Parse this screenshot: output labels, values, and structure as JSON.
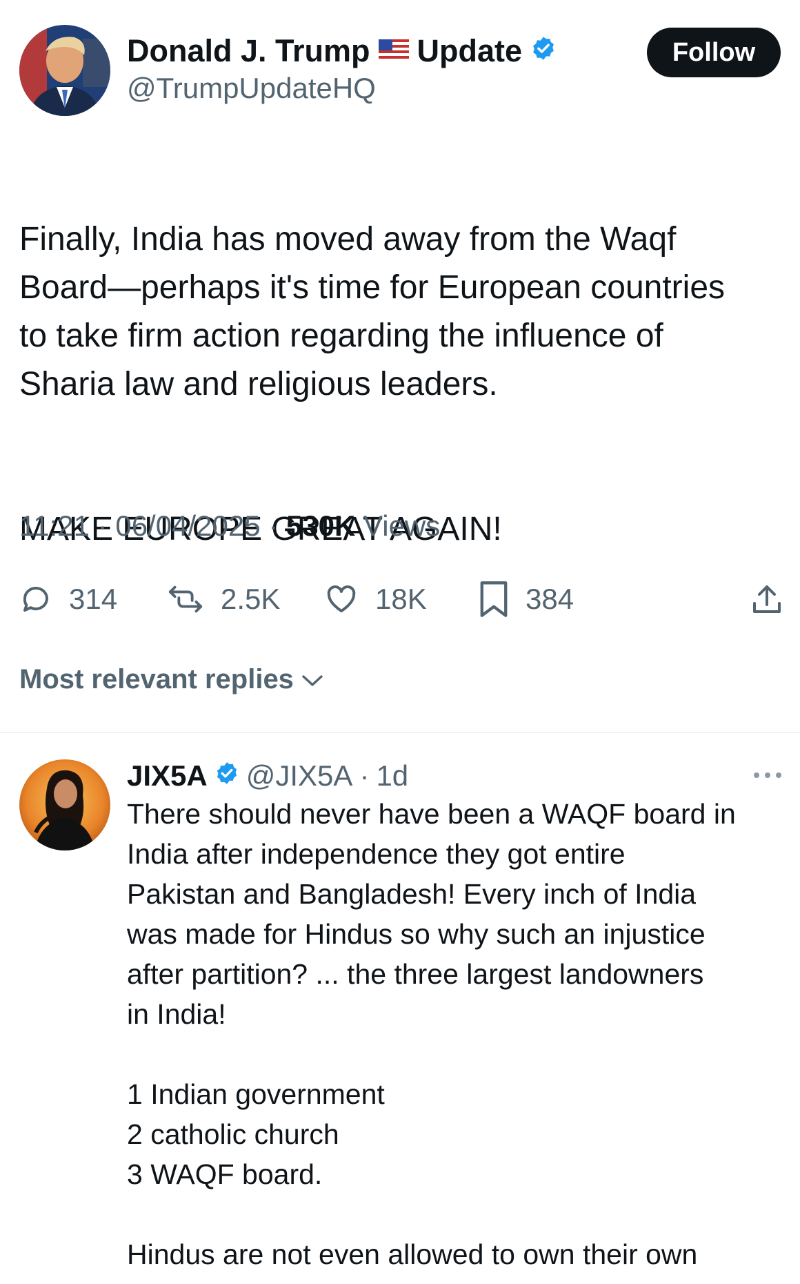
{
  "post": {
    "author_name": "Donald J. Trump",
    "author_name_suffix": "Update",
    "author_handle": "@TrumpUpdateHQ",
    "follow_label": "Follow",
    "text_main": "Finally, India has moved away from the Waqf\nBoard—perhaps it's time for European countries\nto take firm action regarding the influence of\nSharia law and religious leaders.",
    "text_slogan": "MAKE EUROPE GREAT AGAIN!",
    "time": "11:21",
    "date": "06/04/2025",
    "views_count": "530K",
    "views_label": "Views",
    "separator": "·"
  },
  "actions": {
    "replies": "314",
    "reposts": "2.5K",
    "likes": "18K",
    "bookmarks": "384"
  },
  "replies_sort": {
    "label": "Most relevant replies"
  },
  "reply": {
    "name": "JIX5A",
    "handle": "@JIX5A",
    "separator": "·",
    "time": "1d",
    "text": "There should never have been a WAQF board in\nIndia after independence they got entire\nPakistan and Bangladesh! Every inch of India\nwas made for Hindus so why such an injustice\nafter partition? ... the three largest landowners\nin India!\n\n 1 Indian government\n2 catholic church\n3 WAQF board.\n\nHindus are not even allowed to own their own"
  },
  "icons": {
    "verified": "verified-badge-icon",
    "flag": "us-flag-icon",
    "reply": "reply-icon",
    "repost": "repost-icon",
    "like": "heart-icon",
    "bookmark": "bookmark-icon",
    "share": "share-icon",
    "chevron": "chevron-down-icon",
    "more": "more-icon"
  },
  "colors": {
    "verified_blue": "#1d9bf0",
    "text_primary": "#0f1419",
    "text_secondary": "#536471",
    "follow_bg": "#0f1419",
    "divider": "#e6e9ec"
  }
}
